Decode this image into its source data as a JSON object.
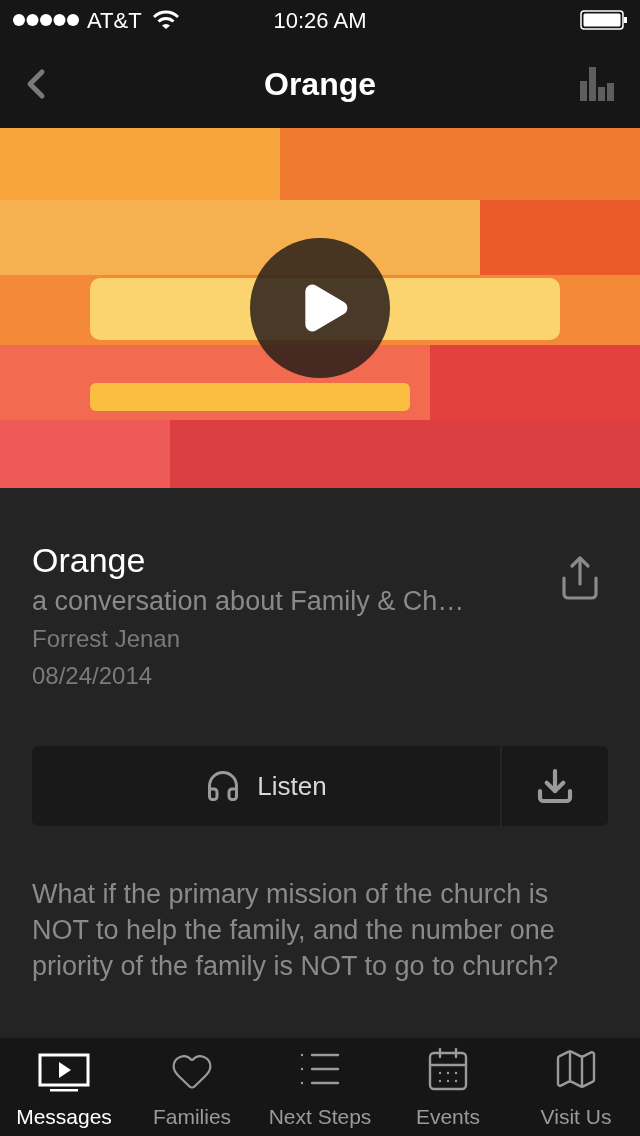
{
  "status_bar": {
    "carrier": "AT&T",
    "time": "10:26 AM"
  },
  "nav_bar": {
    "title": "Orange"
  },
  "details": {
    "title": "Orange",
    "subtitle": "a conversation about Family & Ch…",
    "speaker": "Forrest Jenan",
    "date": "08/24/2014"
  },
  "listen_button": {
    "label": "Listen"
  },
  "description": [
    "What if the primary mission of the church is NOT to help the family, and the number one priority of the family is NOT to go to church?"
  ],
  "tab_bar": [
    {
      "label": "Messages",
      "kind": "tv",
      "selected": true
    },
    {
      "label": "Families",
      "kind": "heart",
      "selected": false
    },
    {
      "label": "Next Steps",
      "kind": "list",
      "selected": false
    },
    {
      "label": "Events",
      "kind": "calendar",
      "selected": false
    },
    {
      "label": "Visit Us",
      "kind": "map",
      "selected": false
    }
  ]
}
